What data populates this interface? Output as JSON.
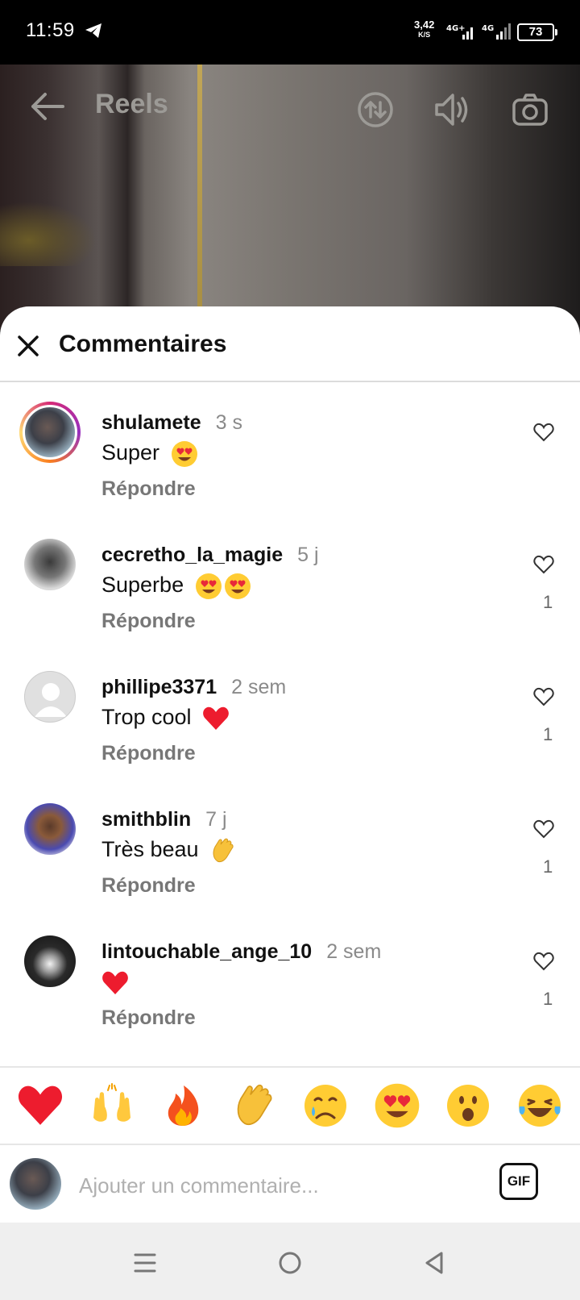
{
  "status_bar": {
    "time": "11:59",
    "net_speed": "3,42",
    "net_speed_unit": "K/S",
    "network_1": "4G+",
    "network_2": "4G",
    "battery": "73"
  },
  "reels_header": {
    "title": "Reels",
    "icons": [
      "back-arrow-icon",
      "swap-icon",
      "volume-icon",
      "camera-icon"
    ]
  },
  "sheet": {
    "title": "Commentaires",
    "comments": [
      {
        "user": "shulamete",
        "time": "3 s",
        "text": "Super",
        "emojis": [
          "heart-eyes"
        ],
        "reply": "Répondre",
        "likes": "",
        "avatar": "story"
      },
      {
        "user": "cecretho_la_magie",
        "time": "5 j",
        "text": "Superbe",
        "emojis": [
          "heart-eyes",
          "heart-eyes"
        ],
        "reply": "Répondre",
        "likes": "1",
        "avatar": "grey-photo"
      },
      {
        "user": "phillipe3371",
        "time": "2 sem",
        "text": "Trop cool",
        "emojis": [
          "red-heart"
        ],
        "reply": "Répondre",
        "likes": "1",
        "avatar": "default"
      },
      {
        "user": "smithblin",
        "time": "7 j",
        "text": "Très beau",
        "emojis": [
          "clap"
        ],
        "reply": "Répondre",
        "likes": "1",
        "avatar": "photo"
      },
      {
        "user": "lintouchable_ange_10",
        "time": "2 sem",
        "text": "",
        "emojis": [
          "red-heart"
        ],
        "reply": "Répondre",
        "likes": "1",
        "avatar": "dark-photo"
      }
    ]
  },
  "emoji_bar": [
    "❤️",
    "🙌",
    "🔥",
    "👏",
    "😢",
    "😍",
    "😮",
    "😂"
  ],
  "composer": {
    "placeholder": "Ajouter un commentaire...",
    "gif_label": "GIF"
  },
  "colors": {
    "story_ring": "#d62976",
    "heart": "#ed1c2e",
    "muted_text": "#8a8a8a"
  }
}
